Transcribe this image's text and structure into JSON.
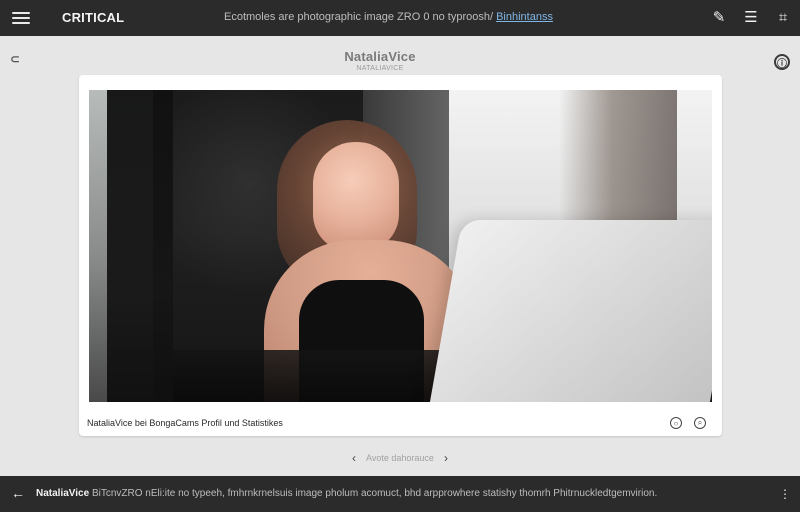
{
  "topbar": {
    "title": "CRITICAL",
    "center_prefix": "Ecotmoles are photographic image ZRO 0 no typroosh/",
    "center_link": "Binhintanss",
    "actions": [
      {
        "name": "edit-icon",
        "glyph": "✎"
      },
      {
        "name": "menu-lines-icon",
        "glyph": "☰"
      },
      {
        "name": "grid-icon",
        "glyph": "⌗"
      }
    ]
  },
  "header": {
    "left_icon": "⊂",
    "brand_name": "NataliaVice",
    "brand_sub": "NATALIAVICE",
    "right_icon": "ⓘ"
  },
  "card": {
    "caption": "NataliaVice bei BongaCams Profil und Statistikes",
    "actions": [
      {
        "name": "circle-icon",
        "glyph": "○"
      },
      {
        "name": "search-icon",
        "glyph": "⌕"
      }
    ]
  },
  "pager": {
    "prev": "‹",
    "label": "Avote dahorauce",
    "next": "›"
  },
  "bottombar": {
    "back": "←",
    "strong": "NataliaVice",
    "text": "BiTcnvZRO nEli:ite no typeeh, fmhrnkrnelsuis image pholum acomuct, bhd arpprowhere statishy thomrh Phitrnuckledtgemvirion.",
    "end": "⋮"
  }
}
